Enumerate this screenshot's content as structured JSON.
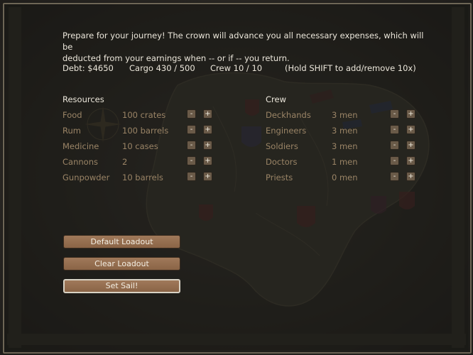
{
  "intro": {
    "line1": "Prepare for your journey! The crown will advance you all necessary expenses, which will be",
    "line2": "deducted from your earnings when -- or if -- you return."
  },
  "stats": {
    "debt": "Debt: $4650",
    "cargo": "Cargo 430 / 500",
    "crew": "Crew 10 / 10",
    "hint": "(Hold SHIFT to add/remove 10x)"
  },
  "resources": {
    "title": "Resources",
    "items": [
      {
        "label": "Food",
        "qty": "100 crates"
      },
      {
        "label": "Rum",
        "qty": "100 barrels"
      },
      {
        "label": "Medicine",
        "qty": "10 cases"
      },
      {
        "label": "Cannons",
        "qty": "2"
      },
      {
        "label": "Gunpowder",
        "qty": "10 barrels"
      }
    ]
  },
  "crew": {
    "title": "Crew",
    "items": [
      {
        "label": "Deckhands",
        "qty": "3 men"
      },
      {
        "label": "Engineers",
        "qty": "3 men"
      },
      {
        "label": "Soldiers",
        "qty": "3 men"
      },
      {
        "label": "Doctors",
        "qty": "1 men"
      },
      {
        "label": "Priests",
        "qty": "0 men"
      }
    ]
  },
  "controls": {
    "minus": "-",
    "plus": "+"
  },
  "buttons": {
    "default_loadout": "Default Loadout",
    "clear_loadout": "Clear Loadout",
    "set_sail": "Set Sail!"
  },
  "colors": {
    "text": "#ebe6da",
    "row_text": "#9a8466",
    "button": "#8f6a4c"
  }
}
